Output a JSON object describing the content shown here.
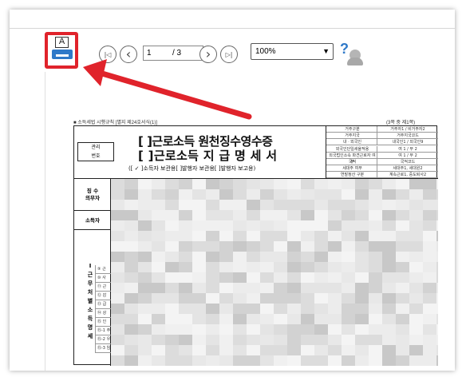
{
  "toolbar": {
    "print_icon_letter": "A",
    "page_current": "1",
    "page_total": "/ 3",
    "zoom_value": "100%",
    "help_label": "?",
    "nav_first": "|◁",
    "nav_prev": "‹",
    "nav_next": "›",
    "nav_last": "▷|"
  },
  "document": {
    "header_left": "■ 소득세법 시행규칙 [별지 제24호서식(1)]",
    "header_right": "(3쪽 중 제1쪽)",
    "title_line1": "[ ]근로소득 원천징수영수증",
    "title_line2": "[ ]근로소득 지 급 명 세 서",
    "subtitle": "([ ✓ ]소득자 보관용[     ]발행자 보관용[     ]발행자 보고용)",
    "mgmt_label_1": "관리",
    "mgmt_label_2": "번호",
    "right_table": [
      {
        "a": "거주구분",
        "b": "거주자1 / 비거주자2"
      },
      {
        "a": "거주지국",
        "b": "거주지국코드"
      },
      {
        "a": "내ㆍ외국인",
        "b": "내국인1 / 외국인9"
      },
      {
        "a": "외국인단일세율적용",
        "b": "여 1 / 부 2"
      },
      {
        "a": "외국법인소속 파견근로자 여부",
        "b": "여 1 / 부 2"
      },
      {
        "a": "국적",
        "b": "국적코드"
      },
      {
        "a": "세대주 여부",
        "b": "세대주1, 세대원2"
      },
      {
        "a": "연말정산 구분",
        "b": "계속근로1, 중도퇴사2"
      }
    ],
    "left_col": {
      "withholder_1": "징 수",
      "withholder_2": "의무자",
      "earner": "소득자",
      "section_vertical": "Ⅰ 근 무 처 별 소 득 명 세",
      "items": [
        "⑨ 근",
        "⑩ 사",
        "⑪ 근",
        "⑫ 감",
        "⑬ 급",
        "⑭ 상",
        "⑮ 인",
        "⑮-1 주",
        "⑮-2 우",
        "⑮-3 임"
      ]
    }
  },
  "colors": {
    "highlight": "#e0232b",
    "accent": "#2f79c8"
  }
}
